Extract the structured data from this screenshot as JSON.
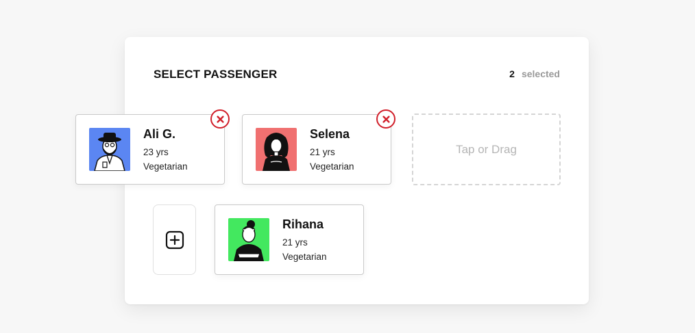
{
  "header": {
    "title": "SELECT PASSENGER",
    "selected_count": "2",
    "selected_label": "selected"
  },
  "selected_passengers": [
    {
      "name": "Ali G.",
      "age": "23 yrs",
      "diet": "Vegetarian",
      "avatar_bg": "#5b86f2"
    },
    {
      "name": "Selena",
      "age": "21 yrs",
      "diet": "Vegetarian",
      "avatar_bg": "#f07070"
    }
  ],
  "dropzone": {
    "label": "Tap or Drag"
  },
  "available_passengers": [
    {
      "name": "Rihana",
      "age": "21 yrs",
      "diet": "Vegetarian",
      "avatar_bg": "#43e85f"
    }
  ],
  "colors": {
    "remove_accent": "#d11f2a",
    "card_border": "#c9c9c9",
    "dropzone_border": "#d4d4d4"
  }
}
